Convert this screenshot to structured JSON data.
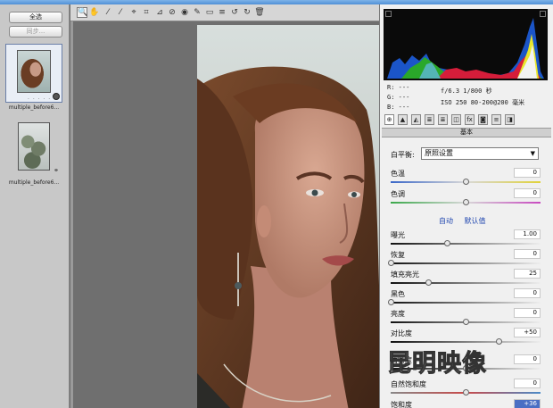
{
  "filmstrip": {
    "select_all": "全选",
    "sync": "同步...",
    "thumbs": [
      {
        "caption": "multiple_before6...",
        "rating": "· · · · ·",
        "selected": true
      },
      {
        "caption": "multiple_before6...",
        "rating": "",
        "selected": false
      }
    ]
  },
  "toolbar": {
    "tools": [
      {
        "icon": "zoom-icon",
        "glyph": "🔍",
        "selected": true
      },
      {
        "icon": "hand-icon",
        "glyph": "✋"
      },
      {
        "icon": "white-balance-icon",
        "glyph": "⁄"
      },
      {
        "icon": "color-sampler-icon",
        "glyph": "⁄"
      },
      {
        "icon": "target-adjust-icon",
        "glyph": "⌖"
      },
      {
        "icon": "crop-icon",
        "glyph": "⌗"
      },
      {
        "icon": "straighten-icon",
        "glyph": "⊿"
      },
      {
        "icon": "spot-removal-icon",
        "glyph": "⊘"
      },
      {
        "icon": "red-eye-icon",
        "glyph": "◉"
      },
      {
        "icon": "adjustment-brush-icon",
        "glyph": "✎"
      },
      {
        "icon": "graduated-filter-icon",
        "glyph": "▭"
      },
      {
        "icon": "preferences-icon",
        "glyph": "≡"
      },
      {
        "icon": "rotate-left-icon",
        "glyph": "↺"
      },
      {
        "icon": "rotate-right-icon",
        "glyph": "↻"
      },
      {
        "icon": "trash-icon",
        "glyph": "🗑"
      }
    ]
  },
  "readout": {
    "r": "R:  ---",
    "g": "G:  ---",
    "b": "B:  ---",
    "exif_line1": "f/6.3   1/800 秒",
    "exif_line2": "ISO 250   80-200@200 毫米"
  },
  "panel": {
    "tabs": [
      "basic-tab-icon",
      "tone-curve-tab-icon",
      "detail-tab-icon",
      "hsl-tab-icon",
      "split-toning-tab-icon",
      "lens-tab-icon",
      "fx-tab-icon",
      "camera-calibration-tab-icon",
      "presets-tab-icon",
      "snapshots-tab-icon"
    ],
    "tab_glyphs": [
      "⊕",
      "▲",
      "◭",
      "≣",
      "≣",
      "◫",
      "fx",
      "◙",
      "≡",
      "◨"
    ],
    "section": "基本",
    "wb_label": "白平衡:",
    "wb_value": "原照设置",
    "auto": "自动",
    "default": "默认值",
    "sliders": [
      {
        "label": "色温",
        "value": "0",
        "pos": 0.5,
        "track": "temp"
      },
      {
        "label": "色调",
        "value": "0",
        "pos": 0.5,
        "track": "tint"
      },
      {
        "label": "曝光",
        "value": "1.00",
        "pos": 0.375,
        "track": "gray"
      },
      {
        "label": "恢复",
        "value": "0",
        "pos": 0.0,
        "track": "gray"
      },
      {
        "label": "填充亮光",
        "value": "25",
        "pos": 0.25,
        "track": "gray"
      },
      {
        "label": "黑色",
        "value": "0",
        "pos": 0.0,
        "track": "gray"
      },
      {
        "label": "亮度",
        "value": "0",
        "pos": 0.5,
        "track": "gray"
      },
      {
        "label": "对比度",
        "value": "+50",
        "pos": 0.72,
        "track": "gray"
      },
      {
        "label": "清晰度",
        "value": "0",
        "pos": 0.5,
        "track": "gray"
      },
      {
        "label": "自然饱和度",
        "value": "0",
        "pos": 0.5,
        "track": "vib"
      },
      {
        "label": "饱和度",
        "value": "+36",
        "pos": 0.68,
        "track": "vib",
        "highlight": true
      }
    ]
  },
  "watermark": "昆明映像"
}
